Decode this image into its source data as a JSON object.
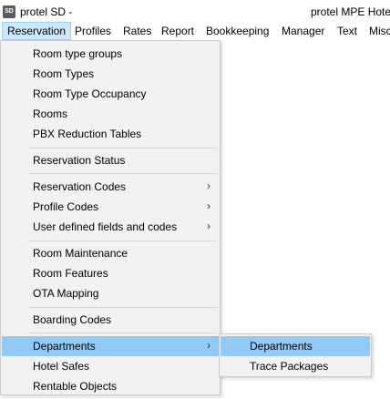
{
  "window": {
    "icon_text": "SD",
    "title_left": "protel SD -",
    "title_right": "protel MPE Hote"
  },
  "menubar": {
    "items": [
      "Reservation",
      "Profiles",
      "Rates",
      "Report",
      "Bookkeeping",
      "Manager",
      "Text",
      "Misc"
    ]
  },
  "dropdown": {
    "items": [
      {
        "label": "Room type groups",
        "has_submenu": false
      },
      {
        "label": "Room Types",
        "has_submenu": false
      },
      {
        "label": "Room Type Occupancy",
        "has_submenu": false
      },
      {
        "label": "Rooms",
        "has_submenu": false
      },
      {
        "label": "PBX Reduction Tables",
        "has_submenu": false
      },
      {
        "label": "Reservation Status",
        "has_submenu": false
      },
      {
        "label": "Reservation Codes",
        "has_submenu": true
      },
      {
        "label": "Profile Codes",
        "has_submenu": true
      },
      {
        "label": "User defined fields and codes",
        "has_submenu": true
      },
      {
        "label": "Room Maintenance",
        "has_submenu": false
      },
      {
        "label": "Room Features",
        "has_submenu": false
      },
      {
        "label": "OTA Mapping",
        "has_submenu": false
      },
      {
        "label": "Boarding Codes",
        "has_submenu": false
      },
      {
        "label": "Departments",
        "has_submenu": true,
        "highlighted": true
      },
      {
        "label": "Hotel Safes",
        "has_submenu": false
      },
      {
        "label": "Rentable Objects",
        "has_submenu": false
      }
    ],
    "submenu_arrow": "›"
  },
  "submenu": {
    "items": [
      {
        "label": "Departments",
        "highlighted": true
      },
      {
        "label": "Trace Packages",
        "highlighted": false
      }
    ]
  },
  "colors": {
    "highlight": "#91c9f7",
    "menubar_active": "#cce8ff",
    "menu_background": "#f2f2f2"
  }
}
